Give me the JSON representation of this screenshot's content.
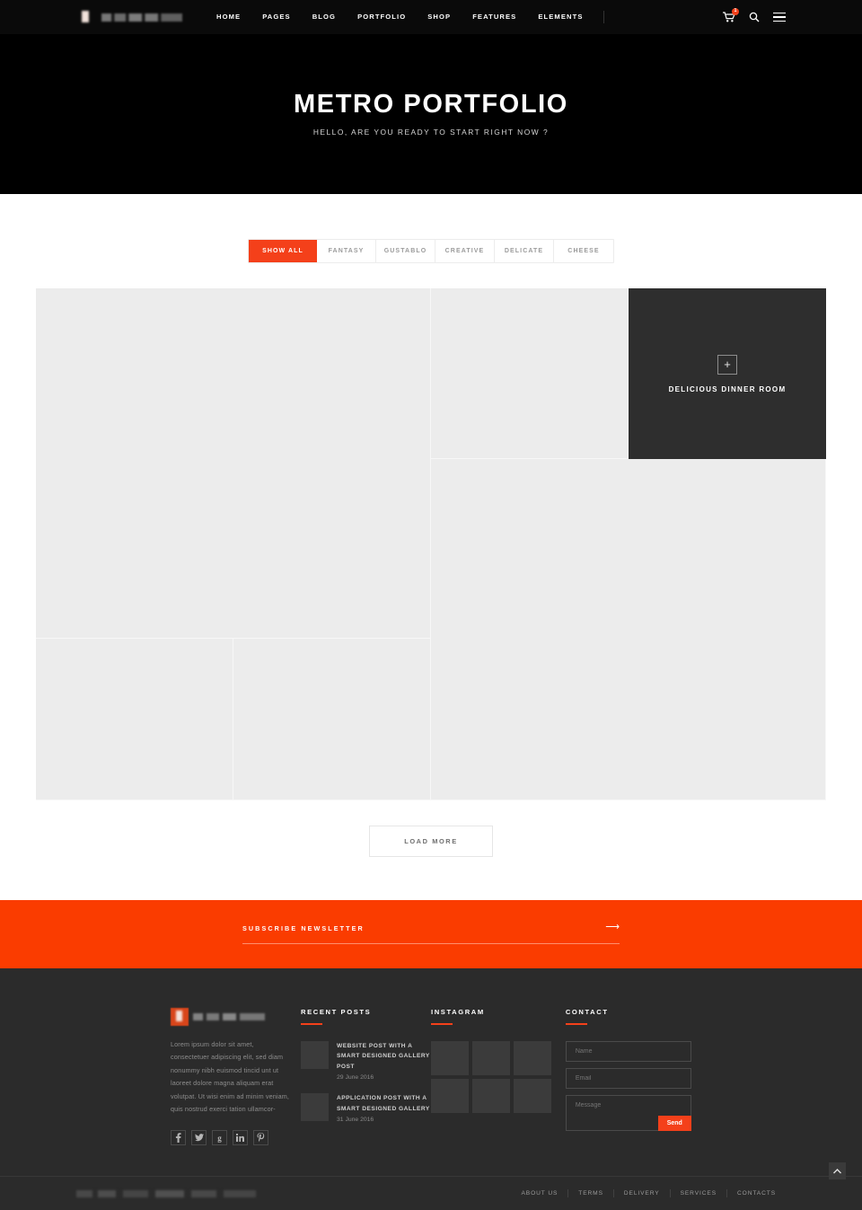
{
  "header": {
    "logo_alt": "site-logo",
    "nav": [
      {
        "label": "HOME",
        "active": true
      },
      {
        "label": "PAGES",
        "active": false
      },
      {
        "label": "BLOG",
        "active": false
      },
      {
        "label": "PORTFOLIO",
        "active": false
      },
      {
        "label": "SHOP",
        "active": false
      },
      {
        "label": "FEATURES",
        "active": false
      },
      {
        "label": "ELEMENTS",
        "active": false
      }
    ],
    "cart_count": "1",
    "icons": [
      "cart-icon",
      "search-icon",
      "menu-icon"
    ]
  },
  "hero": {
    "title": "METRO PORTFOLIO",
    "subtitle": "HELLO, ARE YOU READY TO START RIGHT NOW ?"
  },
  "filters": [
    {
      "label": "SHOW ALL",
      "active": true
    },
    {
      "label": "FANTASY",
      "active": false
    },
    {
      "label": "GUSTABLO",
      "active": false
    },
    {
      "label": "CREATIVE",
      "active": false
    },
    {
      "label": "DELICATE",
      "active": false
    },
    {
      "label": "CHEESE",
      "active": false
    }
  ],
  "portfolio": {
    "tiles": [
      {
        "title": "",
        "hovered": false
      },
      {
        "title": "",
        "hovered": false
      },
      {
        "title": "DELICIOUS DINNER ROOM",
        "hovered": true
      },
      {
        "title": "",
        "hovered": false
      },
      {
        "title": "",
        "hovered": false
      },
      {
        "title": "",
        "hovered": false
      }
    ],
    "load_more_label": "LOAD MORE"
  },
  "newsletter": {
    "label": "SUBSCRIBE NEWSLETTER",
    "value": "",
    "submit_icon": "arrow-right-icon",
    "accent": "#fa3c00"
  },
  "footer": {
    "about": {
      "text": "Lorem ipsum dolor sit amet, consectetuer adipiscing elit, sed diam nonummy nibh euismod tincid  unt ut laoreet dolore magna aliquam erat volutpat. Ut wisi enim ad minim veniam, quis nostrud exerci tation ullamcor-",
      "socials": [
        {
          "name": "facebook-icon",
          "glyph": "f"
        },
        {
          "name": "twitter-icon",
          "glyph": "ᵗ"
        },
        {
          "name": "google-plus-icon",
          "glyph": "g"
        },
        {
          "name": "linkedin-icon",
          "glyph": "in"
        },
        {
          "name": "pinterest-icon",
          "glyph": "P"
        }
      ]
    },
    "recent_posts": {
      "heading": "RECENT POSTS",
      "items": [
        {
          "title": "WEBSITE POST WITH A SMART DESIGNED GALLERY POST",
          "date": "29 June 2016"
        },
        {
          "title": "APPLICATION POST WITH A SMART DESIGNED GALLERY",
          "date": "31 June 2016"
        }
      ]
    },
    "instagram": {
      "heading": "INSTAGRAM",
      "count": 6
    },
    "contact": {
      "heading": "CONTACT",
      "name_placeholder": "Name",
      "email_placeholder": "Email",
      "message_placeholder": "Message",
      "send_label": "Send",
      "name_value": "",
      "email_value": "",
      "message_value": ""
    },
    "bottom_links": [
      {
        "label": "ABOUT US"
      },
      {
        "label": "TERMS"
      },
      {
        "label": "DELIVERY"
      },
      {
        "label": "SERVICES"
      },
      {
        "label": "CONTACTS"
      }
    ],
    "to_top_icon": "chevron-up-icon"
  }
}
